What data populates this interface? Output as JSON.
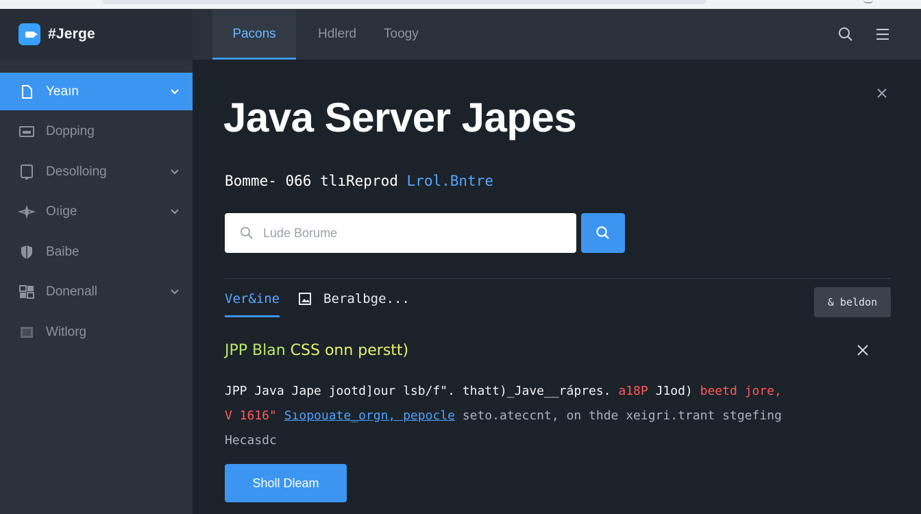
{
  "brand": {
    "title": "#Jerge"
  },
  "sidebar": {
    "items": [
      {
        "label": "Yeaın",
        "icon": "file-icon",
        "active": true,
        "has_chevron": true
      },
      {
        "label": "Dopping",
        "icon": "monitor-icon",
        "active": false,
        "has_chevron": false
      },
      {
        "label": "Desolloing",
        "icon": "tablet-icon",
        "active": false,
        "has_chevron": true
      },
      {
        "label": "Oıige",
        "icon": "compass-icon",
        "active": false,
        "has_chevron": true
      },
      {
        "label": "Baibe",
        "icon": "shield-icon",
        "active": false,
        "has_chevron": false
      },
      {
        "label": "Donenall",
        "icon": "grid-icon",
        "active": false,
        "has_chevron": true
      },
      {
        "label": "Witlorg",
        "icon": "box-icon",
        "active": false,
        "has_chevron": false
      }
    ]
  },
  "header": {
    "tabs": [
      {
        "label": "Pacons",
        "active": true
      },
      {
        "label": "Hdlerd",
        "active": false
      },
      {
        "label": "Toogy",
        "active": false
      }
    ]
  },
  "main": {
    "title": "Java Server Japes",
    "subtitle": "Bomme- 066 tlıReprod",
    "subtitle_link": "Lrol.Bntre",
    "search": {
      "placeholder": "Lude Borume"
    },
    "subtabs": {
      "active": "Ver&ine",
      "second": "Beralbge..."
    },
    "ghost_button": "& beldon",
    "notice": {
      "title_part1": "JPP Blan",
      "title_part2": "CSS onn perstt)"
    },
    "body": {
      "line1_text": "JPP Java Jape jootd]our lsb/f\". thatt)_Jave__rápres.",
      "line1_red1": "a18P",
      "line1_mid": "J1od)",
      "line1_red2": "beetd jore,",
      "line2_red": "V 1616\"",
      "line2_link": "Sıopouate_orgn, pepocle",
      "line2_muted": "seto.ateccnt, on thde xeigri.trant stgefing",
      "line3_muted": "Hecasdc"
    },
    "primary_button": "Sholl Dleam"
  },
  "colors": {
    "accent": "#3c95f0",
    "sidebar_bg": "#2b323c",
    "main_bg": "#1c2229",
    "link": "#55a6ff",
    "error": "#ff5a5a"
  }
}
